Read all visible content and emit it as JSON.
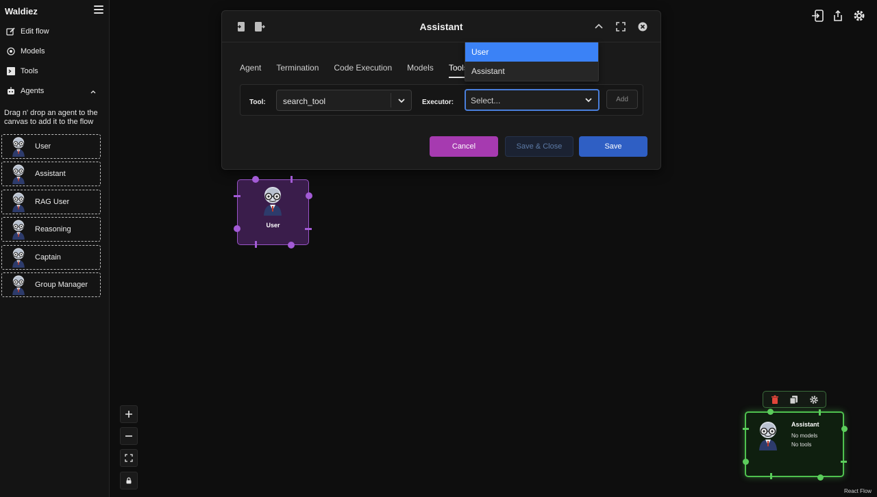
{
  "sidebar": {
    "brand": "Waldiez",
    "nav": {
      "edit_flow": "Edit flow",
      "models": "Models",
      "tools": "Tools",
      "agents": "Agents"
    },
    "hint": "Drag n' drop an agent to the canvas to add it to the flow",
    "agents": [
      {
        "label": "User"
      },
      {
        "label": "Assistant"
      },
      {
        "label": "RAG User"
      },
      {
        "label": "Reasoning"
      },
      {
        "label": "Captain"
      },
      {
        "label": "Group Manager"
      }
    ]
  },
  "modal": {
    "title": "Assistant",
    "tabs": [
      "Agent",
      "Termination",
      "Code Execution",
      "Models",
      "Tools"
    ],
    "active_tab": "Tools",
    "tool_label": "Tool:",
    "tool_value": "search_tool",
    "executor_label": "Executor:",
    "executor_placeholder": "Select...",
    "add_label": "Add",
    "cancel_label": "Cancel",
    "save_close_label": "Save & Close",
    "save_label": "Save"
  },
  "dropdown": {
    "options": [
      "User",
      "Assistant"
    ],
    "highlighted": "User"
  },
  "canvas": {
    "user_node": {
      "label": "User"
    },
    "assistant_node": {
      "title": "Assistant",
      "models": "No models",
      "tools": "No tools"
    },
    "attribution": "React Flow"
  },
  "colors": {
    "accent_purple": "#a63ab0",
    "accent_blue": "#2f5fc4",
    "node_green": "#4fc24f",
    "node_purple": "#9a55c9"
  }
}
